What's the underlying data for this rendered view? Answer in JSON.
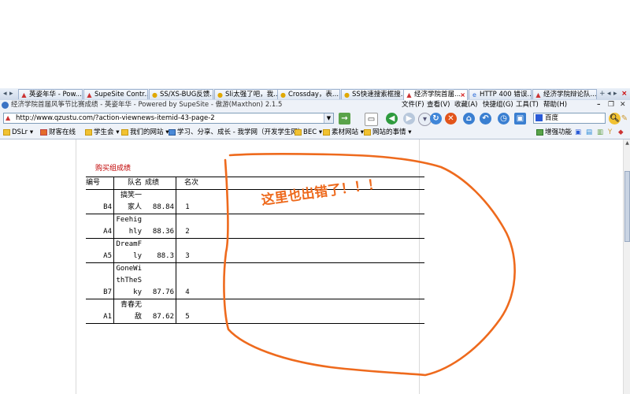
{
  "tabs": [
    {
      "label": "英姿年华 - Pow...",
      "icon": "supesite-icon",
      "active": false
    },
    {
      "label": "SupeSite Contr...",
      "icon": "supesite-icon",
      "active": false
    },
    {
      "label": "SS/XS-BUG反馈...",
      "icon": "discuz-icon",
      "active": false
    },
    {
      "label": "Sli太强了吧，我...",
      "icon": "discuz-icon",
      "active": false
    },
    {
      "label": "Crossday，表...",
      "icon": "discuz-icon",
      "active": false
    },
    {
      "label": "SS快速搜索框搜...",
      "icon": "discuz-icon",
      "active": false
    },
    {
      "label": "经济学院首届...",
      "icon": "supesite-icon",
      "active": true
    },
    {
      "label": "HTTP 400 错误...",
      "icon": "ie-icon",
      "active": false
    },
    {
      "label": "经济学院辩论队...",
      "icon": "supesite-icon",
      "active": false
    }
  ],
  "window": {
    "title": "经济学院首届风筝节比赛成绩 - 英姿年华 - Powered by SupeSite - 傲游(Maxthon) 2.1.5"
  },
  "menu": [
    "文件(F)",
    "查看(V)",
    "收藏(A)",
    "快捷组(G)",
    "工具(T)",
    "帮助(H)"
  ],
  "address": {
    "url": "http://www.qzustu.com/?action-viewnews-itemid-43-page-2"
  },
  "search": {
    "engine": "百度"
  },
  "toolbar_right": {
    "enhance_label": "增强功能"
  },
  "favorites": [
    "DSLr",
    "财客在线",
    "学生会",
    "我们的网站",
    "学习、分享、成长 - 我学网（开发学生网）",
    "BEC",
    "素材网站",
    "网站的事情"
  ],
  "content": {
    "section_title": "购买组成绩",
    "table": {
      "headers": {
        "num": "编号",
        "team": "队名",
        "score": "成绩",
        "rank": "名次"
      },
      "rows": [
        {
          "num": "B4",
          "team": "搞笑一家人",
          "score": "88.84",
          "rank": "1"
        },
        {
          "num": "A4",
          "team": "Feehighly",
          "score": "88.36",
          "rank": "2"
        },
        {
          "num": "A5",
          "team": "DreamFly",
          "score": "88.3",
          "rank": "3"
        },
        {
          "num": "B7",
          "team": "GoneWithTheSky",
          "score": "87.76",
          "rank": "4"
        },
        {
          "num": "A1",
          "team": "青春无敌",
          "score": "87.62",
          "rank": "5"
        }
      ]
    },
    "annotation": "这里也出错了！！！"
  },
  "colors": {
    "annotation": "#ee6a1d",
    "section_title": "#c00000",
    "tab_active": "#ffffff",
    "chrome": "#eef2f8"
  }
}
